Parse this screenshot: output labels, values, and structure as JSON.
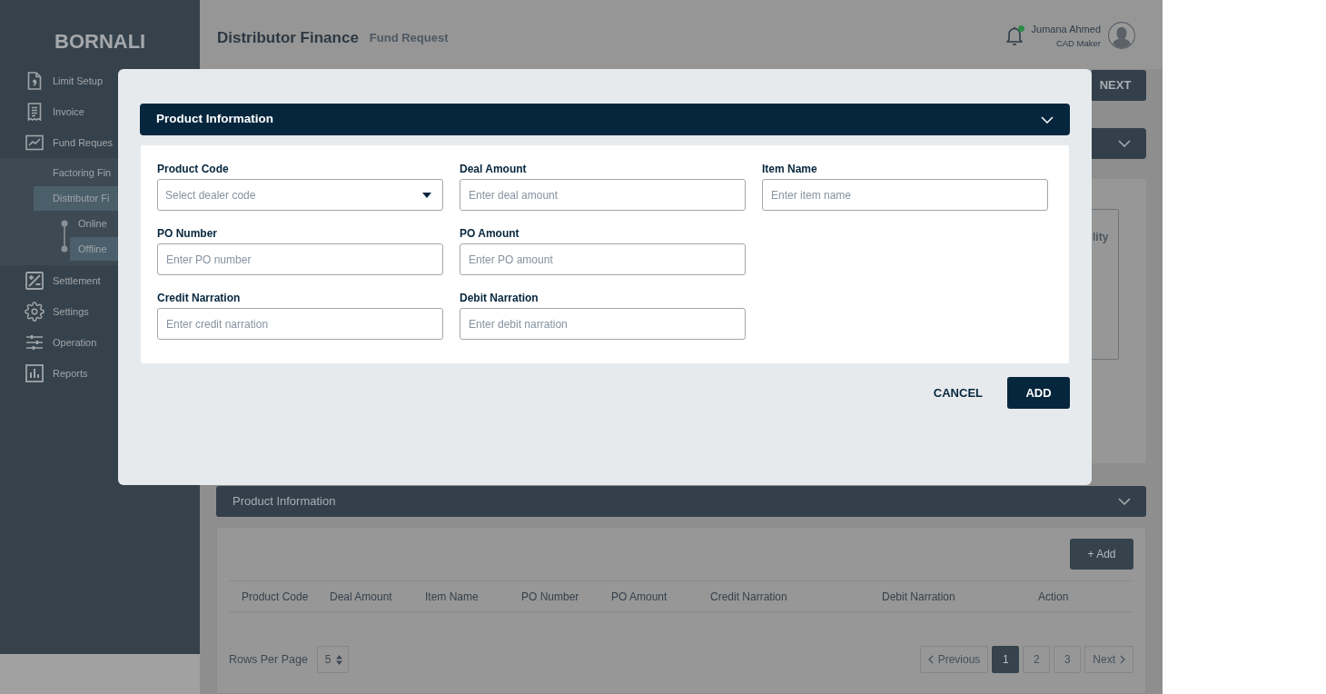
{
  "sidebar": {
    "logo": "BORNALI",
    "items": [
      {
        "label": "Limit Setup"
      },
      {
        "label": "Invoice"
      },
      {
        "label": "Fund Reques",
        "children": [
          {
            "label": "Factoring Fin",
            "selected": false
          },
          {
            "label": "Distributor Fi",
            "selected": true,
            "children": [
              {
                "label": "Online",
                "selected": false
              },
              {
                "label": "Offline",
                "selected": true
              }
            ]
          }
        ]
      },
      {
        "label": "Settlement"
      },
      {
        "label": "Settings"
      },
      {
        "label": "Operation"
      },
      {
        "label": "Reports"
      }
    ]
  },
  "header": {
    "title": "Distributor Finance",
    "subtitle": "Fund Request",
    "notification": true,
    "user": {
      "name": "Jumana Ahmed",
      "role": "CAD Maker"
    }
  },
  "page": {
    "next_button": "NEXT",
    "panel_text": "lity",
    "product_section": {
      "title": "Product Information",
      "add_button": "+ Add",
      "table": {
        "columns": [
          "Product Code",
          "Deal Amount",
          "Item Name",
          "PO Number",
          "PO Amount",
          "Credit Narration",
          "Debit Narration",
          "Action"
        ]
      },
      "rows_per_page": {
        "label": "Rows Per Page",
        "value": "5"
      },
      "pagination": {
        "previous": "Previous",
        "pages": [
          {
            "label": "1",
            "selected": true
          },
          {
            "label": "2",
            "selected": false
          },
          {
            "label": "3",
            "selected": false
          }
        ],
        "next": "Next"
      }
    }
  },
  "dialog": {
    "title": "Product Information",
    "rows": [
      [
        {
          "label": "Product Code",
          "placeholder": "Select dealer code",
          "kind": "select"
        },
        {
          "label": "Deal Amount",
          "placeholder": "Enter deal amount",
          "kind": "text"
        },
        {
          "label": "Item Name",
          "placeholder": "Enter item name",
          "kind": "text"
        }
      ],
      [
        {
          "label": "PO Number",
          "placeholder": "Enter PO number",
          "kind": "text"
        },
        {
          "label": "PO Amount",
          "placeholder": "Enter PO amount",
          "kind": "text"
        }
      ],
      [
        {
          "label": "Credit Narration",
          "placeholder": "Enter credit narration",
          "kind": "text"
        },
        {
          "label": "Debit Narration",
          "placeholder": "Enter debit narration",
          "kind": "text"
        }
      ]
    ],
    "buttons": [
      {
        "label": "CANCEL",
        "kind": "secondary"
      },
      {
        "label": "ADD",
        "kind": "primary"
      }
    ]
  }
}
